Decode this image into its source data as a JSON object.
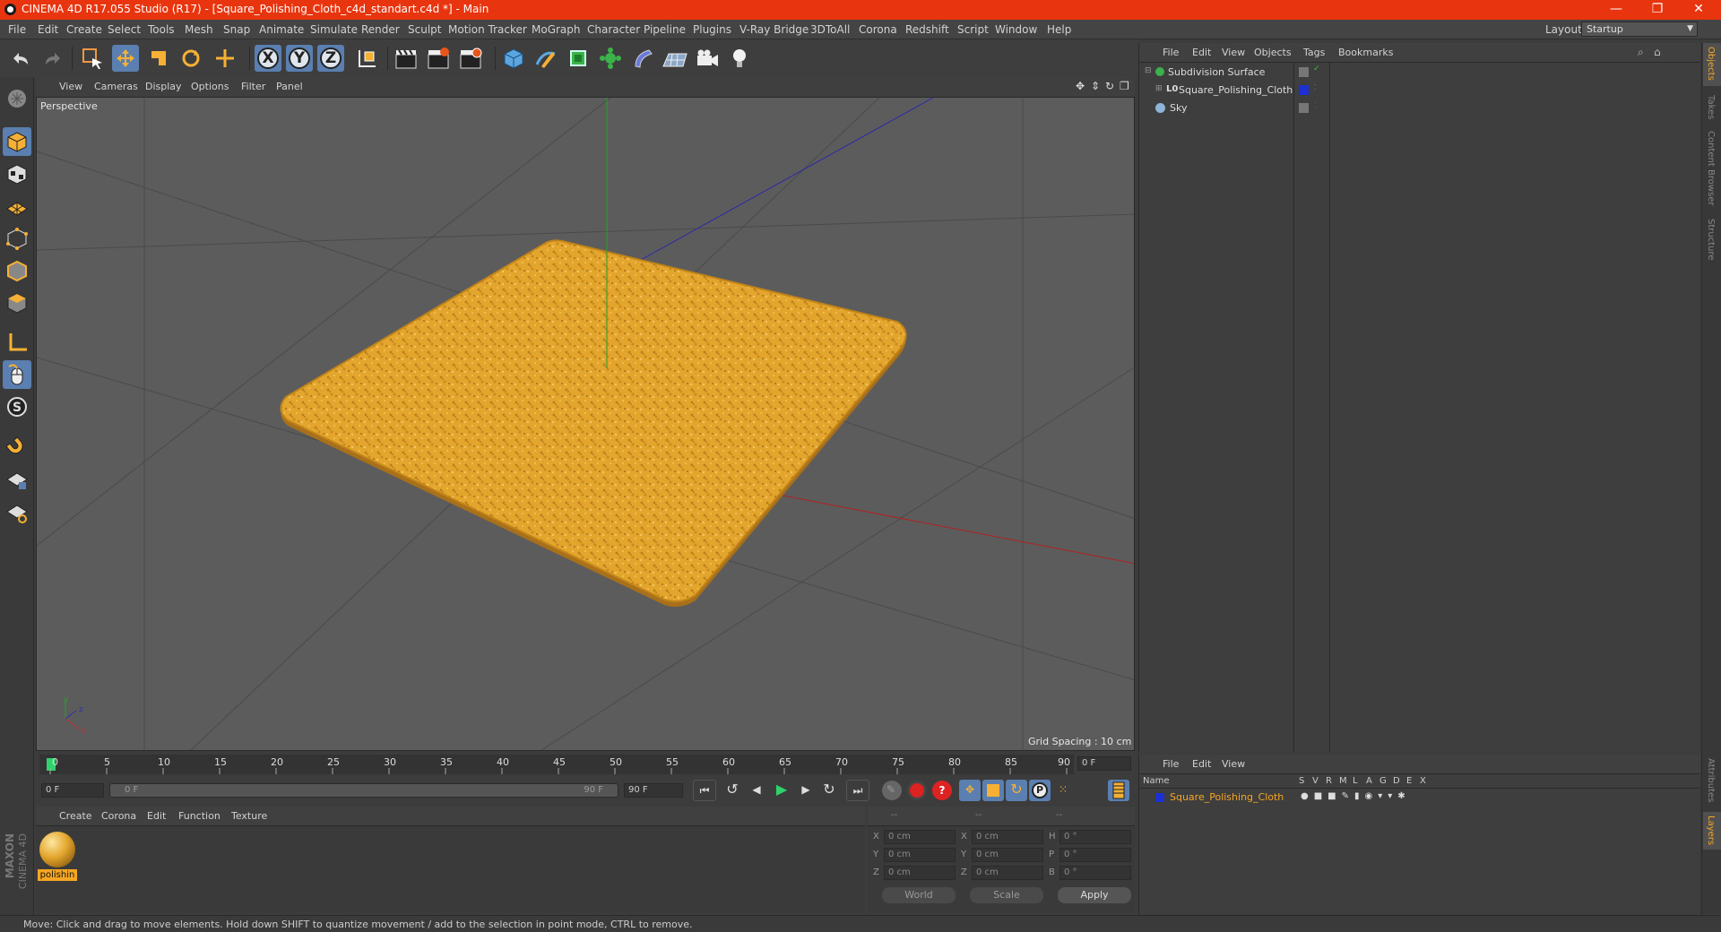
{
  "window": {
    "title": "CINEMA 4D R17.055 Studio (R17) - [Square_Polishing_Cloth_c4d_standart.c4d *] - Main",
    "controls": [
      "—",
      "❐",
      "✕"
    ]
  },
  "menubar": {
    "items": [
      "File",
      "Edit",
      "Create",
      "Select",
      "Tools",
      "Mesh",
      "Snap",
      "Animate",
      "Simulate",
      "Render",
      "Sculpt",
      "Motion Tracker",
      "MoGraph",
      "Character",
      "Pipeline",
      "Plugins",
      "V-Ray Bridge",
      "3DToAll",
      "Corona",
      "Redshift",
      "Script",
      "Window",
      "Help"
    ],
    "layout_label": "Layout:",
    "layout_value": "Startup"
  },
  "toolbar": {
    "axis_x": "X",
    "axis_y": "Y",
    "axis_z": "Z"
  },
  "viewport": {
    "menu": [
      "View",
      "Cameras",
      "Display",
      "Options",
      "Filter",
      "Panel"
    ],
    "camera_label": "Perspective",
    "grid_spacing": "Grid Spacing : 10 cm",
    "axis_y": "y",
    "axis_z": "z",
    "axis_x": "x"
  },
  "timeline": {
    "ticks": [
      "0",
      "5",
      "10",
      "15",
      "20",
      "25",
      "30",
      "35",
      "40",
      "45",
      "50",
      "55",
      "60",
      "65",
      "70",
      "75",
      "80",
      "85",
      "90"
    ],
    "current_frame": "0 F",
    "start_field": "0 F",
    "slider_start": "0 F",
    "slider_end": "90 F",
    "end_field": "90 F"
  },
  "material_panel": {
    "menu": [
      "Create",
      "Corona",
      "Edit",
      "Function",
      "Texture"
    ],
    "material_name": "polishin"
  },
  "coordinates": {
    "headers": [
      "--",
      "--",
      "--"
    ],
    "rows": [
      {
        "a": "X",
        "av": "0 cm",
        "b": "X",
        "bv": "0 cm",
        "c": "H",
        "cv": "0 °"
      },
      {
        "a": "Y",
        "av": "0 cm",
        "b": "Y",
        "bv": "0 cm",
        "c": "P",
        "cv": "0 °"
      },
      {
        "a": "Z",
        "av": "0 cm",
        "b": "Z",
        "bv": "0 cm",
        "c": "B",
        "cv": "0 °"
      }
    ],
    "world": "World",
    "scale": "Scale",
    "apply": "Apply"
  },
  "object_manager": {
    "menu": [
      "File",
      "Edit",
      "View",
      "Objects",
      "Tags",
      "Bookmarks"
    ],
    "objects": [
      "Subdivision Surface",
      "Square_Polishing_Cloth",
      "Sky"
    ]
  },
  "layer_manager": {
    "menu": [
      "File",
      "Edit",
      "View"
    ],
    "columns": [
      "Name",
      "S",
      "V",
      "R",
      "M",
      "L",
      "A",
      "G",
      "D",
      "E",
      "X"
    ],
    "row_name": "Square_Polishing_Cloth"
  },
  "right_tabs": {
    "top": [
      "Objects",
      "Takes",
      "Content Browser",
      "Structure"
    ],
    "bottom": [
      "Attributes",
      "Layers"
    ]
  },
  "logo": {
    "brand": "MAXON",
    "product": "CINEMA 4D"
  },
  "statusbar": {
    "text": "Move: Click and drag to move elements. Hold down SHIFT to quantize movement / add to the selection in point mode, CTRL to remove."
  },
  "colors": {
    "titlebar": "#e8350f",
    "accent": "#5a7fb0",
    "cloth": "#e0a128",
    "object_name_active": "#f5a623"
  }
}
